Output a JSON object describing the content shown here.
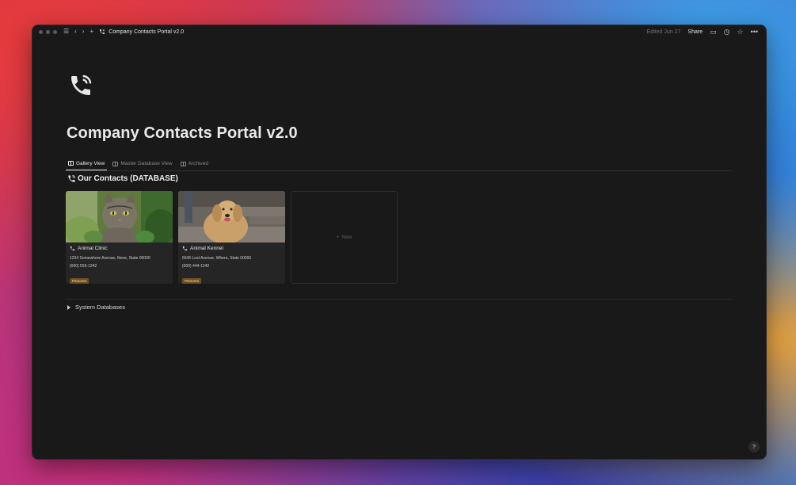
{
  "window": {
    "title": "Company Contacts Portal v2.0",
    "edited": "Edited Jun 27",
    "share_label": "Share"
  },
  "page": {
    "title": "Company Contacts Portal v2.0",
    "icon": "phone-call-icon"
  },
  "tabs": [
    {
      "label": "Gallery View",
      "active": true
    },
    {
      "label": "Master Database View",
      "active": false
    },
    {
      "label": "Archived",
      "active": false
    }
  ],
  "database": {
    "title": "Our Contacts (DATABASE)",
    "cards": [
      {
        "name": "Animal Clinic",
        "address": "1234 Somewhere Avenue, None, State 00000",
        "phone": "(000) 555-1242",
        "tag": "Personal",
        "image": "cat-photo"
      },
      {
        "name": "Animal Kennel",
        "address": "5645 Lost Avenue, Where, State 00000",
        "phone": "(000) 444-1242",
        "tag": "Personal",
        "image": "dog-photo"
      }
    ],
    "new_label": "New"
  },
  "toggle": {
    "label": "System Databases"
  },
  "help_label": "?",
  "colors": {
    "background": "#191919",
    "tag_bg": "#6b4f1e"
  }
}
